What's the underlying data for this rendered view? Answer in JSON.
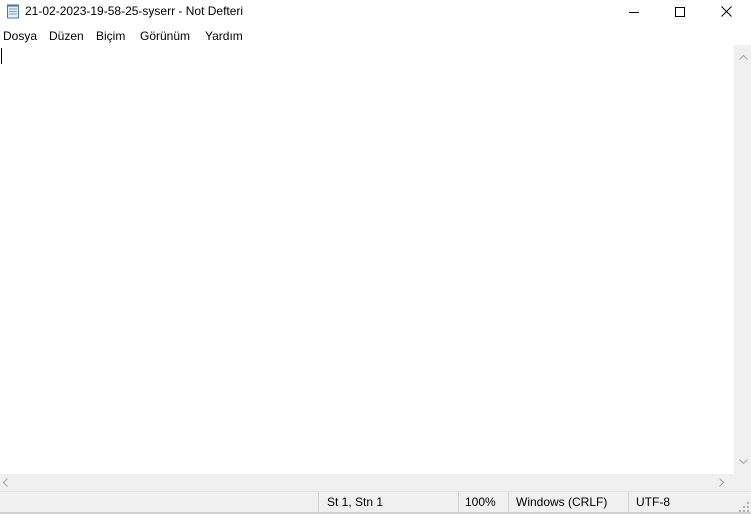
{
  "window": {
    "title": "21-02-2023-19-58-25-syserr - Not Defteri",
    "app_icon": "notepad-icon",
    "controls": {
      "minimize_icon": "minimize-icon",
      "maximize_icon": "maximize-icon",
      "close_icon": "close-icon"
    }
  },
  "menu": {
    "items": [
      "Dosya",
      "Düzen",
      "Biçim",
      "Görünüm",
      "Yardım"
    ]
  },
  "editor": {
    "content": ""
  },
  "statusbar": {
    "position": "St 1, Stn 1",
    "zoom": "100%",
    "line_endings": "Windows (CRLF)",
    "encoding": "UTF-8"
  }
}
